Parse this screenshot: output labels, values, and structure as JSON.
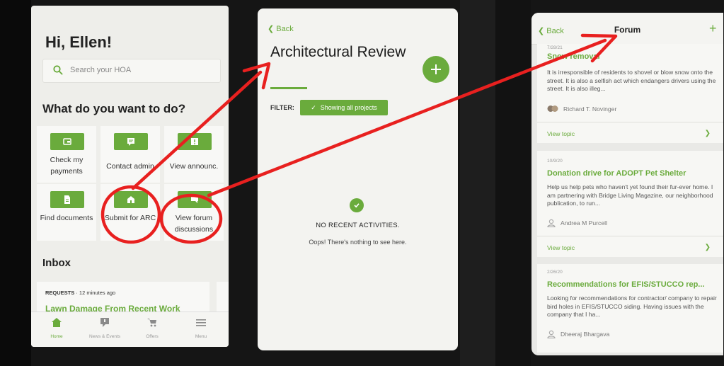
{
  "colors": {
    "accent": "#6aab3c",
    "annotation": "#e8201f",
    "backdrop": "#151515"
  },
  "home": {
    "greeting": "Hi, Ellen!",
    "search_placeholder": "Search your HOA",
    "section_title": "What do you want to do?",
    "tiles": [
      {
        "label": "Check my payments",
        "icon": "wallet-icon"
      },
      {
        "label": "Contact admin",
        "icon": "chat-icon"
      },
      {
        "label": "View announc.",
        "icon": "announcement-icon"
      },
      {
        "label": "Find documents",
        "icon": "document-icon"
      },
      {
        "label": "Submit for ARC",
        "icon": "house-icon"
      },
      {
        "label": "View forum discussions",
        "icon": "forum-icon"
      }
    ],
    "inbox_title": "Inbox",
    "inbox_item": {
      "meta_type": "REQUESTS",
      "meta_time": " · 12 minutes ago",
      "title": "Lawn Damage From Recent Work"
    },
    "tabs": [
      {
        "label": "Home",
        "icon": "home-icon",
        "active": true
      },
      {
        "label": "News & Events",
        "icon": "news-icon",
        "active": false
      },
      {
        "label": "Offers",
        "icon": "cart-icon",
        "active": false
      },
      {
        "label": "Menu",
        "icon": "menu-icon",
        "active": false
      }
    ]
  },
  "arc": {
    "back_label": "Back",
    "title": "Architectural Review",
    "filter_label": "FILTER:",
    "filter_value": "Showing all projects",
    "empty_title": "NO RECENT ACTIVITIES.",
    "empty_subtitle": "Oops! There's nothing to see here."
  },
  "forum": {
    "back_label": "Back",
    "title": "Forum",
    "view_topic_label": "View topic",
    "posts": [
      {
        "date": "7/28/21",
        "title": "Snow removal",
        "body": "It is irresponsible of residents to shovel or blow snow onto the street. It is also a selfish act which endangers drivers using the street. It is also illeg...",
        "author": "Richard T. Novinger"
      },
      {
        "date": "10/9/20",
        "title": "Donation drive for ADOPT Pet Shelter",
        "body": "Help us help pets who haven't yet found their fur-ever home. I am partnering with Bridge Living Magazine, our neighborhood publication, to run...",
        "author": "Andrea M Purcell"
      },
      {
        "date": "2/26/20",
        "title": "Recommendations for EFIS/STUCCO rep...",
        "body": "Looking for recommendations for contractor/ company to repair bird holes in EFIS/STUCCO siding. Having issues with the company that I ha...",
        "author": "Dheeraj Bhargava"
      }
    ]
  }
}
